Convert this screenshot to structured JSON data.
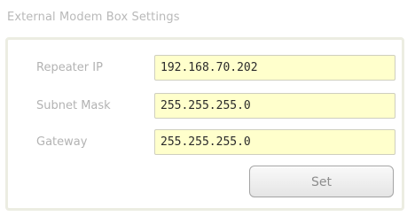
{
  "section": {
    "title": "External Modem Box Settings"
  },
  "form": {
    "repeater_ip": {
      "label": "Repeater IP",
      "value": "192.168.70.202"
    },
    "subnet_mask": {
      "label": "Subnet Mask",
      "value": "255.255.255.0"
    },
    "gateway": {
      "label": "Gateway",
      "value": "255.255.255.0"
    },
    "set_label": "Set"
  },
  "colors": {
    "input_background": "#ffffcc",
    "panel_border": "#ecede2",
    "label_text": "#b3b3b3"
  }
}
